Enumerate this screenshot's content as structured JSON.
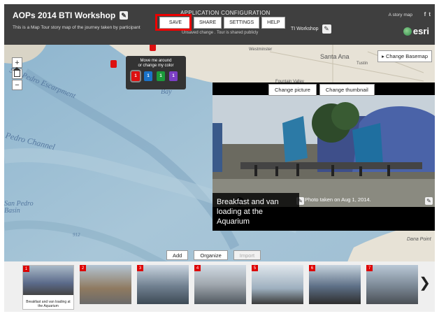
{
  "header": {
    "title": "AOPs 2014 BTI Workshop",
    "subtitle": "This is a Map Tour story map of the journey taken by participant",
    "builder_title": "APPLICATION CONFIGURATION",
    "buttons": {
      "save": "SAVE",
      "share": "SHARE",
      "settings": "SETTINGS",
      "help": "HELP"
    },
    "status_unsaved": "Unsaved change",
    "status_shared": ". Tour is shared publicly",
    "tagline": "TI Workshop",
    "story_map_label": "A story map",
    "share_icons": {
      "facebook": "f",
      "twitter": "t"
    },
    "logo_text": "esri"
  },
  "map": {
    "change_basemap": "Change Basemap",
    "popup_hint": {
      "line1": "Move me around",
      "line2": "or change my color"
    },
    "pins": [
      {
        "label": "1",
        "color": "#d11"
      },
      {
        "label": "1",
        "color": "#1a73c9"
      },
      {
        "label": "1",
        "color": "#1c9a3b"
      },
      {
        "label": "1",
        "color": "#7b3fc6"
      }
    ],
    "labels": {
      "san_pedro_escarpment": "San Pedro Escarpment",
      "bay": "Bay",
      "pedro_channel": "Pedro Channel",
      "san_pedro_basin": "San Pedro",
      "basin": "Basin",
      "depth_912": "912",
      "santa_ana": "Santa Ana",
      "tustin": "Tustin",
      "westminster": "Westminster",
      "fountain_valley": "Fountain Valley",
      "dana_point": "Dana Point"
    }
  },
  "media": {
    "change_picture": "Change picture",
    "change_thumbnail": "Change thumbnail",
    "caption": "Breakfast and van loading at the Aquarium",
    "photo_caption": "Photo taken on Aug 1, 2014."
  },
  "carousel": {
    "add": "Add",
    "organize": "Organize",
    "import": "Import",
    "items": [
      {
        "num": "1",
        "label": "Breakfast and van loading at the Aquarium"
      },
      {
        "num": "2",
        "label": ""
      },
      {
        "num": "3",
        "label": ""
      },
      {
        "num": "4",
        "label": ""
      },
      {
        "num": "5",
        "label": ""
      },
      {
        "num": "6",
        "label": ""
      },
      {
        "num": "7",
        "label": ""
      }
    ]
  }
}
